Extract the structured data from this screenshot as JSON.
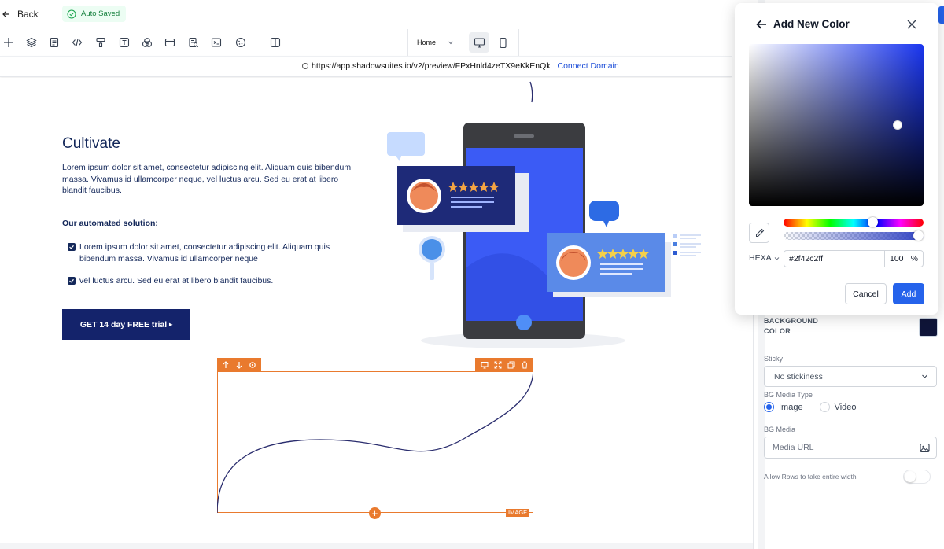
{
  "header": {
    "back_label": "Back",
    "autosave_label": "Auto Saved"
  },
  "toolbar": {
    "tools": [
      "add",
      "layers",
      "pages",
      "code",
      "paint",
      "text",
      "color-wheel",
      "layout",
      "search-doc",
      "terminal",
      "cookie",
      "columns"
    ],
    "page_selector": "Home",
    "devices": [
      "desktop",
      "mobile"
    ],
    "active_device": "desktop"
  },
  "url_bar": {
    "url": "https://app.shadowsuites.io/v2/preview/FPxHnld4zeTX9eKkEnQk",
    "connect_label": "Connect Domain"
  },
  "canvas": {
    "title": "Cultivate",
    "body": "Lorem ipsum dolor sit amet, consectetur adipiscing elit. Aliquam quis bibendum massa. Vivamus id ullamcorper neque, vel luctus arcu. Sed eu erat at libero blandit faucibus.",
    "solution_heading": "Our automated solution:",
    "checklist": [
      "Lorem ipsum dolor sit amet, consectetur adipiscing elit. Aliquam quis bibendum massa. Vivamus id ullamcorper neque",
      "vel luctus arcu. Sed eu erat at libero blandit faucibus."
    ],
    "cta_label": "GET 14 day FREE trial",
    "cta_arrow": "▸",
    "image_tag": "IMAGE",
    "add_symbol": "+"
  },
  "settings_panel": {
    "bg_color_label": "BACKGROUND COLOR",
    "bg_color_value": "#0f1539",
    "sticky_label": "Sticky",
    "sticky_value": "No stickiness",
    "bg_media_type_label": "BG Media Type",
    "media_types": [
      "Image",
      "Video"
    ],
    "selected_media_type": "Image",
    "bg_media_label": "BG Media",
    "media_url_placeholder": "Media URL",
    "allow_rows_label": "Allow Rows to take entire width",
    "allow_rows_enabled": false
  },
  "color_picker": {
    "title": "Add New Color",
    "mode": "HEXA",
    "hex_value": "#2f42c2ff",
    "alpha_value": "100",
    "alpha_unit": "%",
    "cancel_label": "Cancel",
    "add_label": "Add",
    "picked_color": "#2f42c2"
  },
  "colors": {
    "accent": "#2563eb",
    "selection": "#e97a2e",
    "navy": "#14236b"
  }
}
